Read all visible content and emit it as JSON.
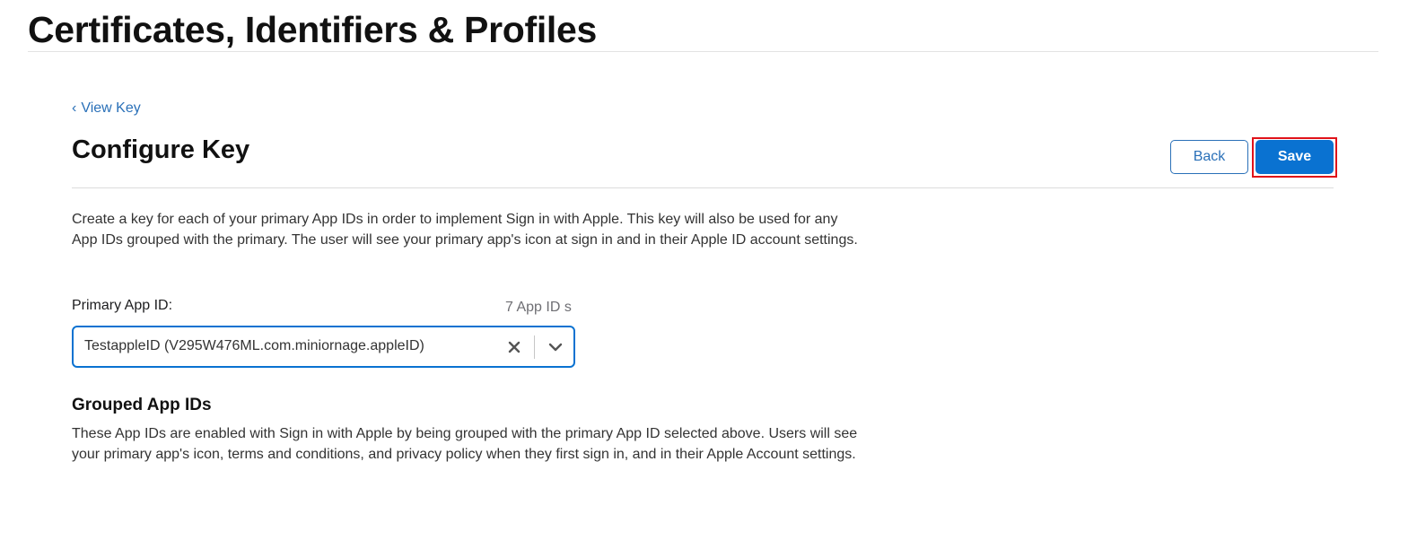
{
  "header": {
    "title": "Certificates, Identifiers & Profiles"
  },
  "nav": {
    "back_link": "View Key",
    "back_chevron": "‹"
  },
  "section": {
    "title": "Configure Key"
  },
  "actions": {
    "back_label": "Back",
    "save_label": "Save"
  },
  "intro": {
    "text": "Create a key for each of your primary App IDs in order to implement Sign in with Apple. This key will also be used for any App IDs grouped with the primary. The user will see your primary app's icon at sign in and in their Apple ID account settings."
  },
  "primary_app_id": {
    "label": "Primary App ID:",
    "count": "7 App ID s",
    "selected_value": "TestappleID (V295W476ML.com.miniornage.appleID)"
  },
  "grouped": {
    "heading": "Grouped App IDs",
    "text": "These App IDs are enabled with Sign in with Apple by being grouped with the primary App ID selected above. Users will see your primary app's icon, terms and conditions, and privacy policy when they first sign in, and in their Apple Account settings."
  },
  "colors": {
    "accent": "#0a72d1",
    "link": "#2a70b8",
    "highlight": "#e0131a"
  },
  "icons": {
    "clear": "close-icon",
    "dropdown": "chevron-down-icon"
  }
}
